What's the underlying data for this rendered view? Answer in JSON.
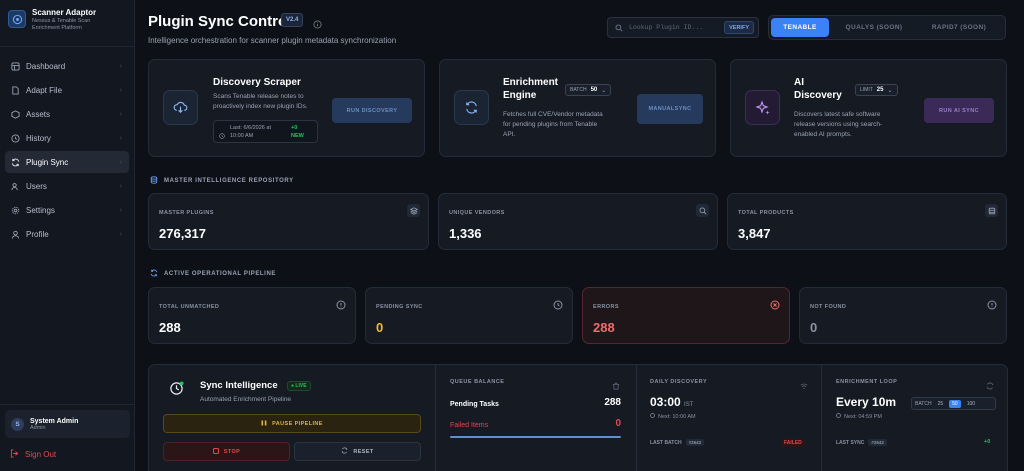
{
  "brand": {
    "title": "Scanner Adaptor",
    "subtitle_line1": "Nessus & Tenable Scan",
    "subtitle_line2": "Enrichment Platform"
  },
  "sidebar": {
    "items": [
      {
        "label": "Dashboard",
        "icon": "dashboard-icon"
      },
      {
        "label": "Adapt File",
        "icon": "file-icon"
      },
      {
        "label": "Assets",
        "icon": "cube-icon"
      },
      {
        "label": "History",
        "icon": "clock-icon"
      },
      {
        "label": "Plugin Sync",
        "icon": "sync-icon",
        "active": true
      },
      {
        "label": "Users",
        "icon": "users-icon"
      },
      {
        "label": "Settings",
        "icon": "gear-icon"
      },
      {
        "label": "Profile",
        "icon": "user-icon"
      }
    ],
    "user": {
      "initial": "S",
      "name": "System Admin",
      "role": "Admin"
    },
    "signout": "Sign Out"
  },
  "header": {
    "title": "Plugin Sync Control",
    "version": "V2.4",
    "subtitle": "Intelligence orchestration for scanner plugin metadata synchronization",
    "search_placeholder": "Lookup Plugin ID...",
    "verify": "VERIFY",
    "tabs": [
      "TENABLE",
      "QUALYS (SOON)",
      "RAPID7 (SOON)"
    ]
  },
  "actions": {
    "discovery": {
      "title": "Discovery Scraper",
      "desc1": "Scans Tenable release notes to",
      "desc2": "proactively index new plugin IDs.",
      "last_label": "Last: 6/6/2026 at",
      "last_time": "10:00 AM",
      "delta": "+0",
      "delta_label": "NEW",
      "button": "RUN DISCOVERY"
    },
    "enrichment": {
      "title1": "Enrichment",
      "title2": "Engine",
      "batch_label": "BATCH",
      "batch_value": "50",
      "desc1": "Fetches full CVE/Vendor metadata",
      "desc2": "for pending plugins from Tenable",
      "desc3": "API.",
      "button1": "MANUAL",
      "button2": "SYNC"
    },
    "ai": {
      "title1": "AI",
      "title2": "Discovery",
      "limit_label": "LIMIT",
      "limit_value": "25",
      "desc1": "Discovers latest safe software",
      "desc2": "release versions using search-",
      "desc3": "enabled AI prompts.",
      "button": "RUN AI SYNC"
    }
  },
  "repository": {
    "heading": "MASTER INTELLIGENCE REPOSITORY",
    "stats": [
      {
        "label": "MASTER PLUGINS",
        "value": "276,317",
        "icon": "layers-icon"
      },
      {
        "label": "UNIQUE VENDORS",
        "value": "1,336",
        "icon": "search-icon"
      },
      {
        "label": "TOTAL PRODUCTS",
        "value": "3,847",
        "icon": "database-icon"
      }
    ]
  },
  "pipeline": {
    "heading": "ACTIVE OPERATIONAL PIPELINE",
    "stats": [
      {
        "label": "TOTAL UNMATCHED",
        "value": "288",
        "icon": "alert-icon",
        "color": "#ffffff"
      },
      {
        "label": "PENDING SYNC",
        "value": "0",
        "icon": "clock-icon",
        "color": "#f5b82e"
      },
      {
        "label": "ERRORS",
        "value": "288",
        "icon": "error-icon",
        "color": "#f26b6b"
      },
      {
        "label": "NOT FOUND",
        "value": "0",
        "icon": "alert-icon",
        "color": "#8a93a3"
      }
    ]
  },
  "sync": {
    "title": "Sync Intelligence",
    "live": "LIVE",
    "subtitle": "Automated Enrichment Pipeline",
    "pause": "PAUSE PIPELINE",
    "stop": "STOP",
    "reset": "RESET",
    "queue": {
      "heading": "QUEUE BALANCE",
      "pending_label": "Pending Tasks",
      "pending_value": "288",
      "failed_label": "Failed Items",
      "failed_value": "0"
    },
    "daily": {
      "heading": "DAILY DISCOVERY",
      "time": "03:00",
      "tz": "IST",
      "next": "Next: 10:00 AM",
      "last_batch": "LAST BATCH",
      "batch_id": "#2643",
      "status": "FAILED"
    },
    "loop": {
      "heading": "ENRICHMENT LOOP",
      "value": "Every 10m",
      "next": "Next: 04:59 PM",
      "batch_label": "BATCH",
      "options": [
        "25",
        "50",
        "100"
      ],
      "selected": "50",
      "last_sync": "LAST SYNC",
      "sync_id": "#2642",
      "delta": "+0"
    }
  },
  "colors": {
    "accent": "#3b82f6",
    "success": "#22c55e",
    "danger": "#e5484d",
    "warning": "#f5b82e",
    "purple": "#a371f7"
  }
}
